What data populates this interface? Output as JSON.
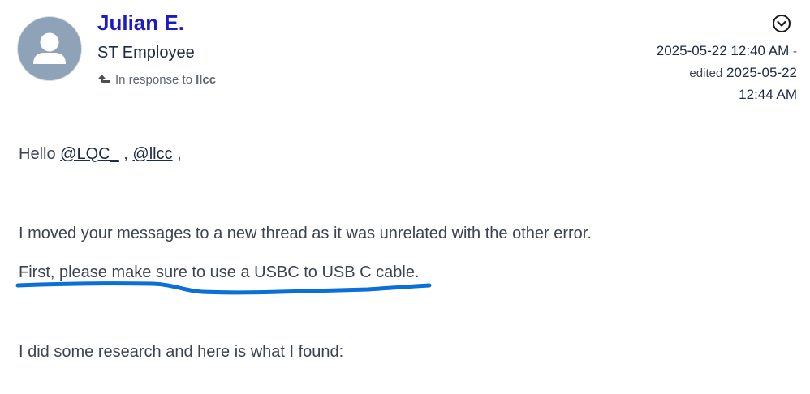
{
  "author": {
    "name": "Julian E.",
    "role": "ST Employee",
    "avatar_icon": "default-user-avatar"
  },
  "in_response": {
    "icon": "reply-arrow-icon",
    "prefix": "In response to",
    "target": "llcc"
  },
  "options_icon": "chevron-down-circle-icon",
  "timestamps": {
    "posted": "2025-05-22 12:40 AM",
    "separator": "-",
    "edited_label": "edited",
    "edited_date": "2025-05-22",
    "edited_time": "12:44 AM"
  },
  "message": {
    "greeting_prefix": "Hello",
    "mention_1": "@LQC_",
    "between": ",",
    "mention_2": "@llcc",
    "greeting_suffix": ",",
    "paragraph_1": "I moved your messages to a new thread as it was unrelated with the other error.",
    "paragraph_2": "First, please make sure to use a USBC to USB C cable.",
    "paragraph_3": "I did some research and here is what I found:"
  },
  "colors": {
    "author_name": "#1c1bc4",
    "annotation_stroke": "#0a6fd6",
    "avatar_bg": "#8ea3b8"
  }
}
